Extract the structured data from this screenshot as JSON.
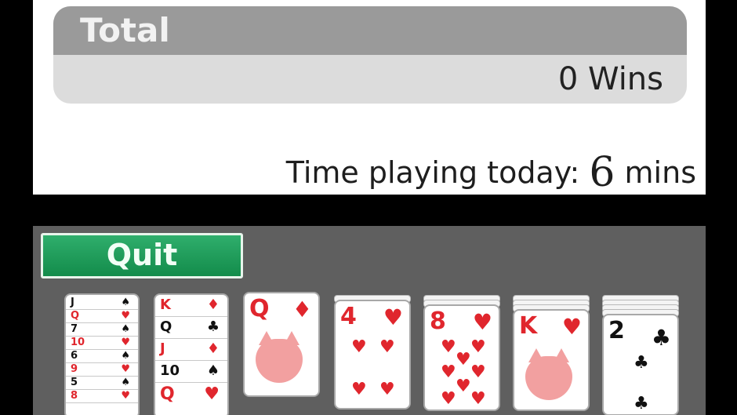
{
  "stats": {
    "total_label": "Total",
    "wins_text": "0 Wins",
    "time_prefix": "Time playing today:",
    "time_value": "6",
    "time_unit": "mins"
  },
  "controls": {
    "quit_label": "Quit"
  },
  "tableau": [
    {
      "column": 1,
      "face_up": [
        "J",
        "Q",
        "7",
        "10",
        "6",
        "9",
        "5",
        "8"
      ],
      "suits": [
        "♠",
        "♥",
        "♠",
        "♥",
        "♠",
        "♥",
        "♠",
        "♥"
      ]
    },
    {
      "column": 2,
      "face_up": [
        "K",
        "Q",
        "J",
        "10",
        "Q"
      ],
      "suits": [
        "♦",
        "♣",
        "♦",
        "♠",
        "♥"
      ]
    },
    {
      "column": 3,
      "top_rank": "Q",
      "top_suit": "♦"
    },
    {
      "column": 4,
      "top_rank": "4",
      "top_suit": "♥"
    },
    {
      "column": 5,
      "top_rank": "8",
      "top_suit": "♥"
    },
    {
      "column": 6,
      "top_rank": "K",
      "top_suit": "♥"
    },
    {
      "column": 7,
      "top_rank": "2",
      "top_suit": "♣"
    }
  ],
  "colors": {
    "felt": "#5f5f5f",
    "quit_button": "#1f9e5b",
    "header": "#9a9a9a",
    "red_suit": "#e0262d"
  }
}
